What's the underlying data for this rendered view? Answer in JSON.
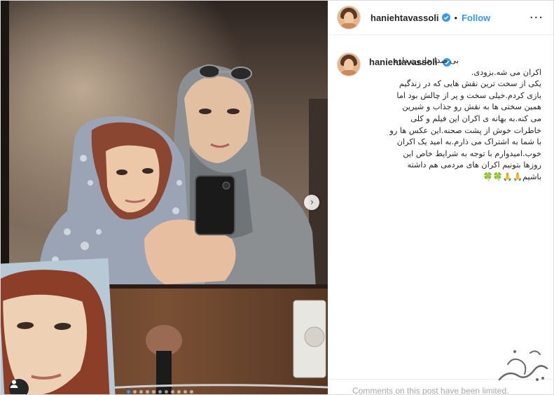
{
  "header": {
    "username": "haniehtavassoli",
    "separator": "•",
    "follow_label": "Follow",
    "more_label": "···"
  },
  "caption": {
    "username": "haniehtavassoli",
    "lines": [
      "بی صدا حلزون داره",
      "اکران می شه.بزودی.",
      "یکی از سخت ترین نقش هایی که در زندگیم",
      "بازی کردم.خیلی سخت و پر از چالش بود اما",
      "همین سختی ها به نقش رو جذاب و شیرین",
      "می کنه.به بهانه ی اکران این فیلم و کلی",
      "خاطرات خوش از پشت صحنه.این عکس ها رو",
      "با شما به اشتراک می ذارم.به امید یک اکران",
      "خوب.امیدوارم با توجه به شرایط خاص این",
      "روزها بتونیم اکران های مردمی هم داشته",
      "باشیم🙏🙏🍀🍀"
    ]
  },
  "footer": {
    "comments_limited": "Comments on this post have been limited."
  },
  "carousel": {
    "slide_count": 11,
    "active_index": 0
  },
  "colors": {
    "accent": "#3897f0",
    "verified": "#3897f0",
    "text": "#262626",
    "muted": "#a8a8a8"
  },
  "icons": [
    "verified-badge-icon",
    "more-options-icon",
    "next-arrow-icon",
    "user-tag-icon"
  ]
}
